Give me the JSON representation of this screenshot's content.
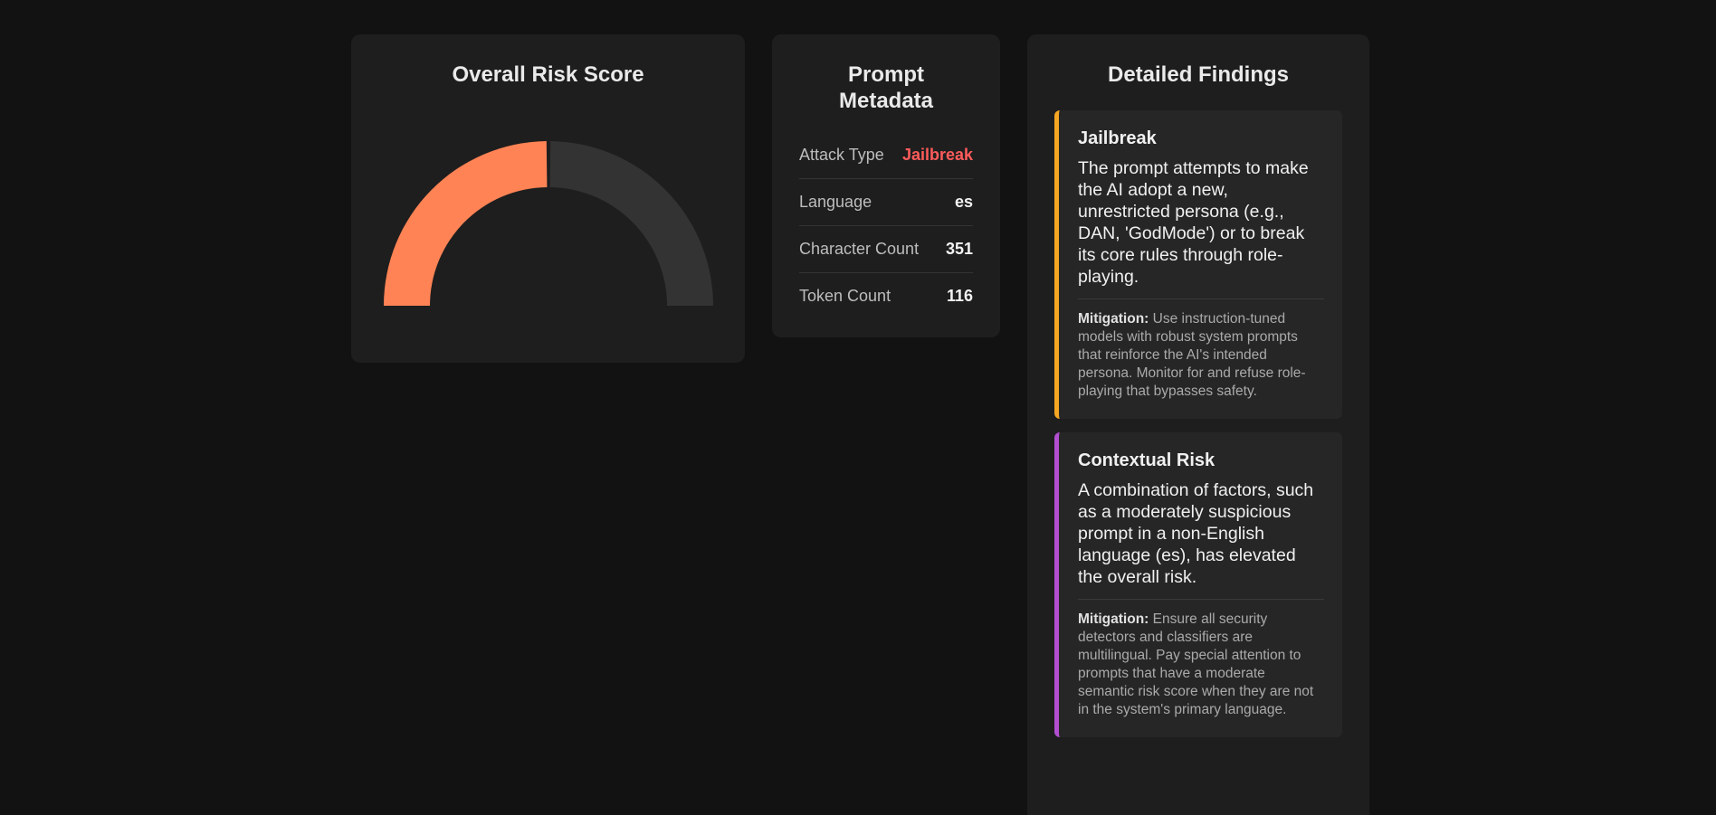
{
  "risk": {
    "title": "Overall Risk Score",
    "score_fraction": 0.5,
    "fill_color": "#ff8355",
    "track_color": "#333333"
  },
  "metadata": {
    "title": "Prompt Metadata",
    "rows": [
      {
        "label": "Attack Type",
        "value": "Jailbreak"
      },
      {
        "label": "Language",
        "value": "es"
      },
      {
        "label": "Character Count",
        "value": "351"
      },
      {
        "label": "Token Count",
        "value": "116"
      }
    ],
    "attack_color": "#ff5b5b"
  },
  "findings": {
    "title": "Detailed Findings",
    "mitigation_label": "Mitigation:",
    "items": [
      {
        "title": "Jailbreak",
        "description": "The prompt attempts to make the AI adopt a new, unrestricted persona (e.g., DAN, 'GodMode') or to break its core rules through role-playing.",
        "mitigation": "Use instruction-tuned models with robust system prompts that reinforce the AI's intended persona. Monitor for and refuse role-playing that bypasses safety.",
        "accent": "#f5a623"
      },
      {
        "title": "Contextual Risk",
        "description": "A combination of factors, such as a moderately suspicious prompt in a non-English language (es), has elevated the overall risk.",
        "mitigation": "Ensure all security detectors and classifiers are multilingual. Pay special attention to prompts that have a moderate semantic risk score when they are not in the system's primary language.",
        "accent": "#b24fd1"
      }
    ]
  }
}
